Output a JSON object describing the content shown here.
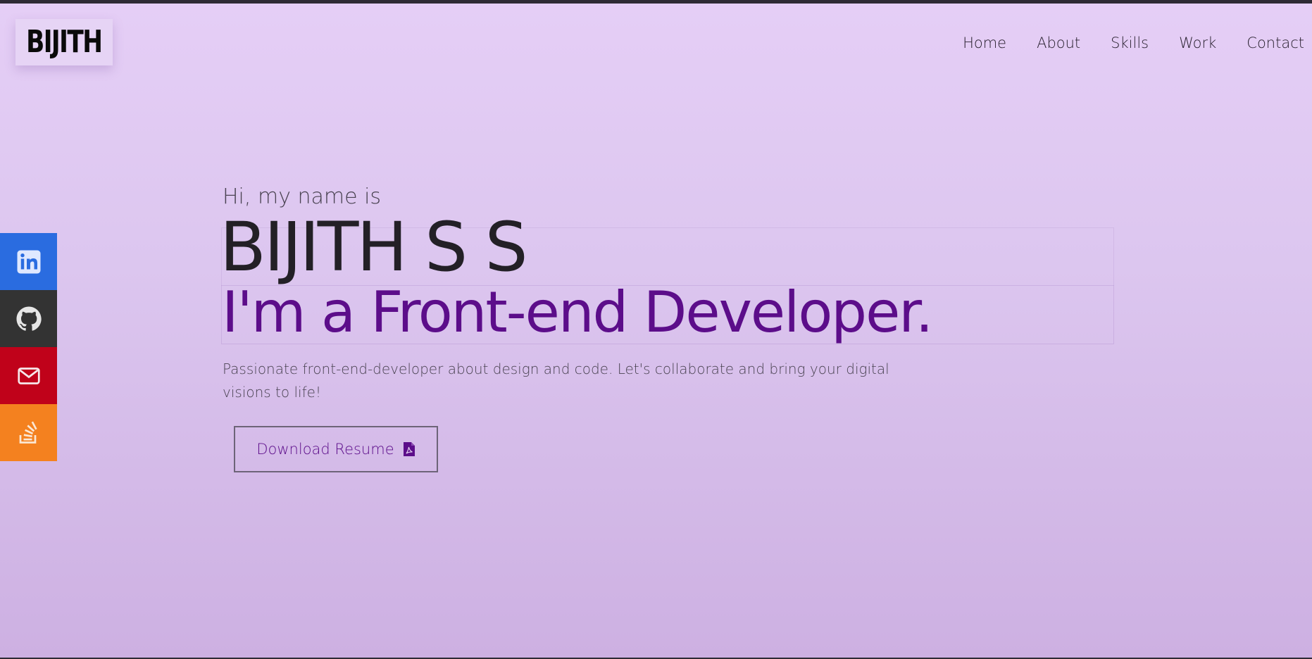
{
  "brand": {
    "logo_text": "BIJITH"
  },
  "nav": {
    "items": [
      {
        "label": "Home"
      },
      {
        "label": "About"
      },
      {
        "label": "Skills"
      },
      {
        "label": "Work"
      },
      {
        "label": "Contact"
      }
    ]
  },
  "social": {
    "items": [
      {
        "name": "linkedin-icon",
        "color": "#2a6ce0"
      },
      {
        "name": "github-icon",
        "color": "#333333"
      },
      {
        "name": "mail-icon",
        "color": "#c0021a"
      },
      {
        "name": "stackoverflow-icon",
        "color": "#f4811f"
      }
    ]
  },
  "hero": {
    "greeting": "Hi, my name is",
    "name": "BIJITH S S",
    "role": "I'm a Front-end Developer.",
    "description": "Passionate front-end-developer about design and code. Let's collaborate and bring your digital visions to life!",
    "resume_button": {
      "label": "Download Resume",
      "icon": "pdf-file-icon"
    }
  },
  "colors": {
    "accent": "#5c0d8a",
    "background_top": "#e5cef6",
    "background_bottom": "#cdb0e2"
  }
}
